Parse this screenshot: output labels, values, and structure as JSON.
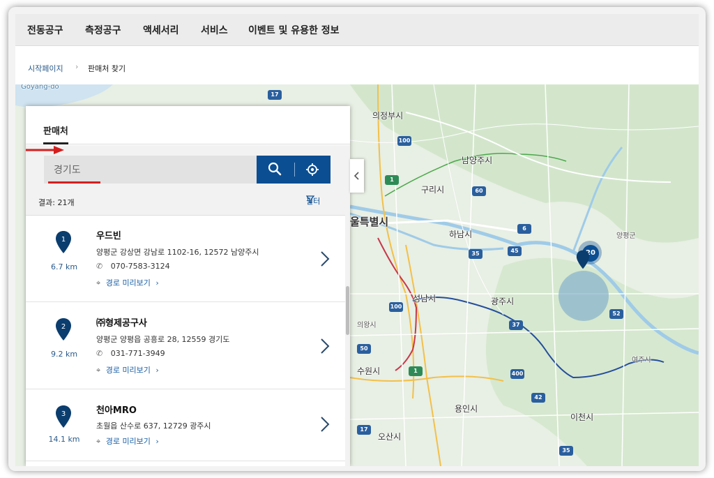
{
  "nav": {
    "items": [
      "전동공구",
      "측정공구",
      "액세서리",
      "서비스",
      "이벤트 및 유용한 정보"
    ]
  },
  "breadcrumb": {
    "home": "시작페이지",
    "current": "판매처 찾기"
  },
  "panel": {
    "tab": "판매처",
    "search_value": "경기도",
    "results_label": "결과: 21개",
    "filter_label": "필터",
    "accent_color": "#0b4e92",
    "annotation_color": "#d41e1e"
  },
  "dealers": [
    {
      "number": "1",
      "distance": "6.7 km",
      "name": "우드빈",
      "address": "양평군 강상면 강남로 1102-16, 12572 남양주시",
      "phone": "070-7583-3124",
      "route": "경로 미리보기"
    },
    {
      "number": "2",
      "distance": "9.2 km",
      "name": "㈜형제공구사",
      "address": "양평군 양평읍 공흥로 28, 12559 경기도",
      "phone": "031-771-3949",
      "route": "경로 미리보기"
    },
    {
      "number": "3",
      "distance": "14.1 km",
      "name": "천아MRO",
      "address": "초월읍 산수로 637, 12729 광주시",
      "phone": "",
      "route": "경로 미리보기"
    }
  ],
  "map": {
    "cluster_count": "20",
    "labels": {
      "seoul": "울특별시",
      "uijeongbu": "의정부시",
      "namyangju": "남양주시",
      "guri": "구리시",
      "hanam": "하남시",
      "seongnam": "성남시",
      "gwangju": "광주시",
      "suwon": "수원시",
      "yongin": "용인시",
      "icheon": "이천시",
      "osan": "오산시",
      "yangpyeong": "양평군",
      "yeoju": "여주시",
      "uiwang": "의왕시",
      "goyang": "Goyang-do"
    },
    "shields": [
      "17",
      "100",
      "1",
      "60",
      "45",
      "6",
      "35",
      "37",
      "52",
      "400",
      "50",
      "17",
      "100",
      "1",
      "42",
      "35"
    ]
  }
}
